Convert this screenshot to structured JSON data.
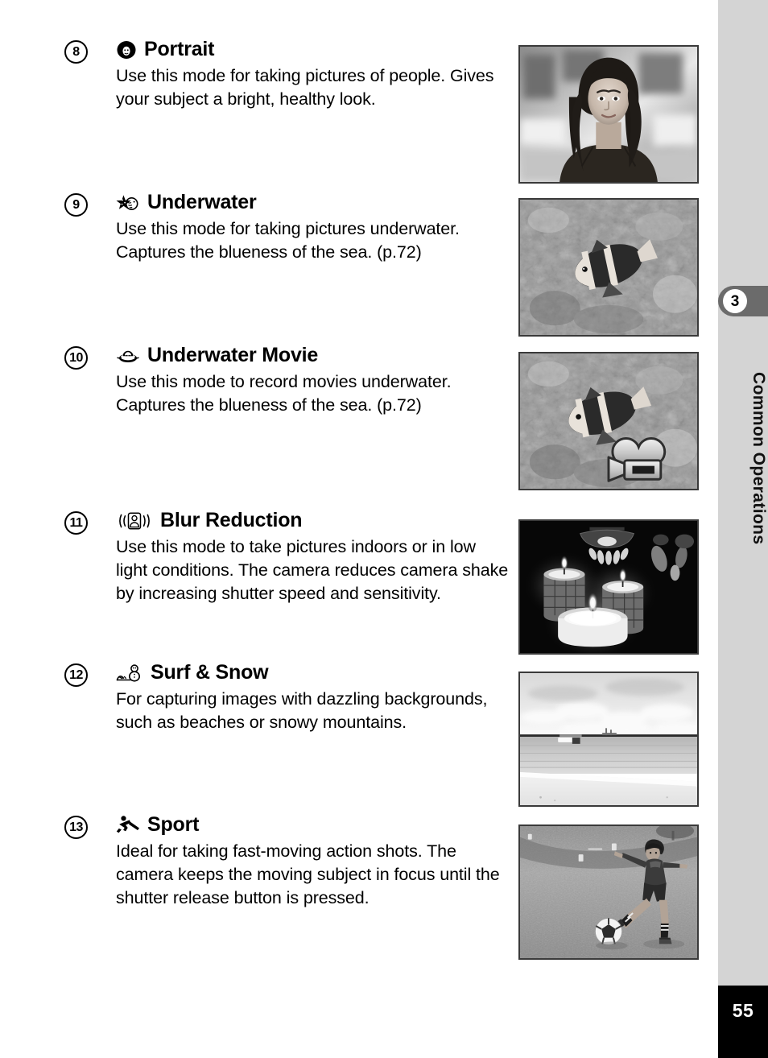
{
  "page": {
    "number": "55",
    "chapter_number": "3",
    "chapter_title": "Common Operations"
  },
  "entries": [
    {
      "number": "8",
      "icon": "portrait-face-icon",
      "title": "Portrait",
      "description": "Use this mode for taking pictures of people. Gives your subject a bright, healthy look.",
      "photo_name": "portrait-photo",
      "photo_caption": "Grayscale portrait photograph of a woman with long dark hair wearing a black camisole, blurred background"
    },
    {
      "number": "9",
      "icon": "underwater-starfish-icon",
      "title": "Underwater",
      "description": "Use this mode for taking pictures underwater. Captures the blueness of the sea. (p.72)",
      "photo_name": "underwater-photo",
      "photo_caption": "Grayscale underwater photograph of a clownfish over coral reef"
    },
    {
      "number": "10",
      "icon": "underwater-movie-icon",
      "title": "Underwater Movie",
      "description": "Use this mode to record movies underwater. Captures the blueness of the sea. (p.72)",
      "photo_name": "underwater-movie-photo",
      "photo_caption": "Grayscale underwater photograph of a clownfish over coral reef with movie camera badge"
    },
    {
      "number": "11",
      "icon": "blur-reduction-icon",
      "title": "Blur Reduction",
      "description": "Use this mode to take pictures indoors or in low light conditions. The camera reduces camera shake by increasing shutter speed and sensitivity.",
      "photo_name": "blur-reduction-photo",
      "photo_caption": "Grayscale low-light photograph of three lit candles in glass holders"
    },
    {
      "number": "12",
      "icon": "surf-and-snow-icon",
      "title": "Surf & Snow",
      "description": "For capturing images with dazzling backgrounds, such as beaches or snowy mountains.",
      "photo_name": "surf-and-snow-photo",
      "photo_caption": "Grayscale photograph of a bright beach with sea, boat and clouded sky"
    },
    {
      "number": "13",
      "icon": "sport-runner-icon",
      "title": "Sport",
      "description": "Ideal for taking fast-moving action shots. The camera keeps the moving subject in focus until the shutter release button is pressed.",
      "photo_name": "sport-photo",
      "photo_caption": "Grayscale photograph of a boy kicking a soccer ball on a grass field"
    }
  ],
  "colors": {
    "rail_background": "#d4d4d4",
    "tab_background": "#6b6b6b",
    "page_number_background": "#000000",
    "text": "#000000"
  }
}
